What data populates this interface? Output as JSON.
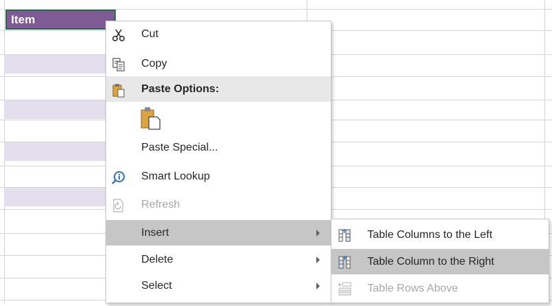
{
  "spreadsheet": {
    "header_cell_text": "Item",
    "colors": {
      "header_fill": "#7e5b95",
      "selection_border": "#1f6f43",
      "banded_row": "#e4dfec",
      "gridline": "#d4d4d4"
    }
  },
  "context_menu": {
    "items": [
      {
        "label": "Cut",
        "icon": "scissors-icon",
        "state": "normal"
      },
      {
        "label": "Copy",
        "icon": "copy-icon",
        "state": "normal"
      },
      {
        "label": "Paste Options:",
        "icon": "paste-icon",
        "state": "section-header"
      },
      {
        "label": "",
        "icon": "paste-icon",
        "state": "normal"
      },
      {
        "label": "Paste Special...",
        "icon": "",
        "state": "normal"
      },
      {
        "label": "Smart Lookup",
        "icon": "smart-lookup-icon",
        "state": "normal"
      },
      {
        "label": "Refresh",
        "icon": "refresh-icon",
        "state": "disabled"
      },
      {
        "label": "Insert",
        "icon": "",
        "state": "highlighted",
        "has_submenu": true
      },
      {
        "label": "Delete",
        "icon": "",
        "state": "normal",
        "has_submenu": true
      },
      {
        "label": "Select",
        "icon": "",
        "state": "normal",
        "has_submenu": true
      }
    ]
  },
  "insert_submenu": {
    "items": [
      {
        "label": "Table Columns to the Left",
        "icon": "insert-column-left-icon",
        "state": "normal"
      },
      {
        "label": "Table Column to the Right",
        "icon": "insert-column-right-icon",
        "state": "highlighted"
      },
      {
        "label": "Table Rows Above",
        "icon": "insert-rows-above-icon",
        "state": "disabled"
      }
    ]
  }
}
